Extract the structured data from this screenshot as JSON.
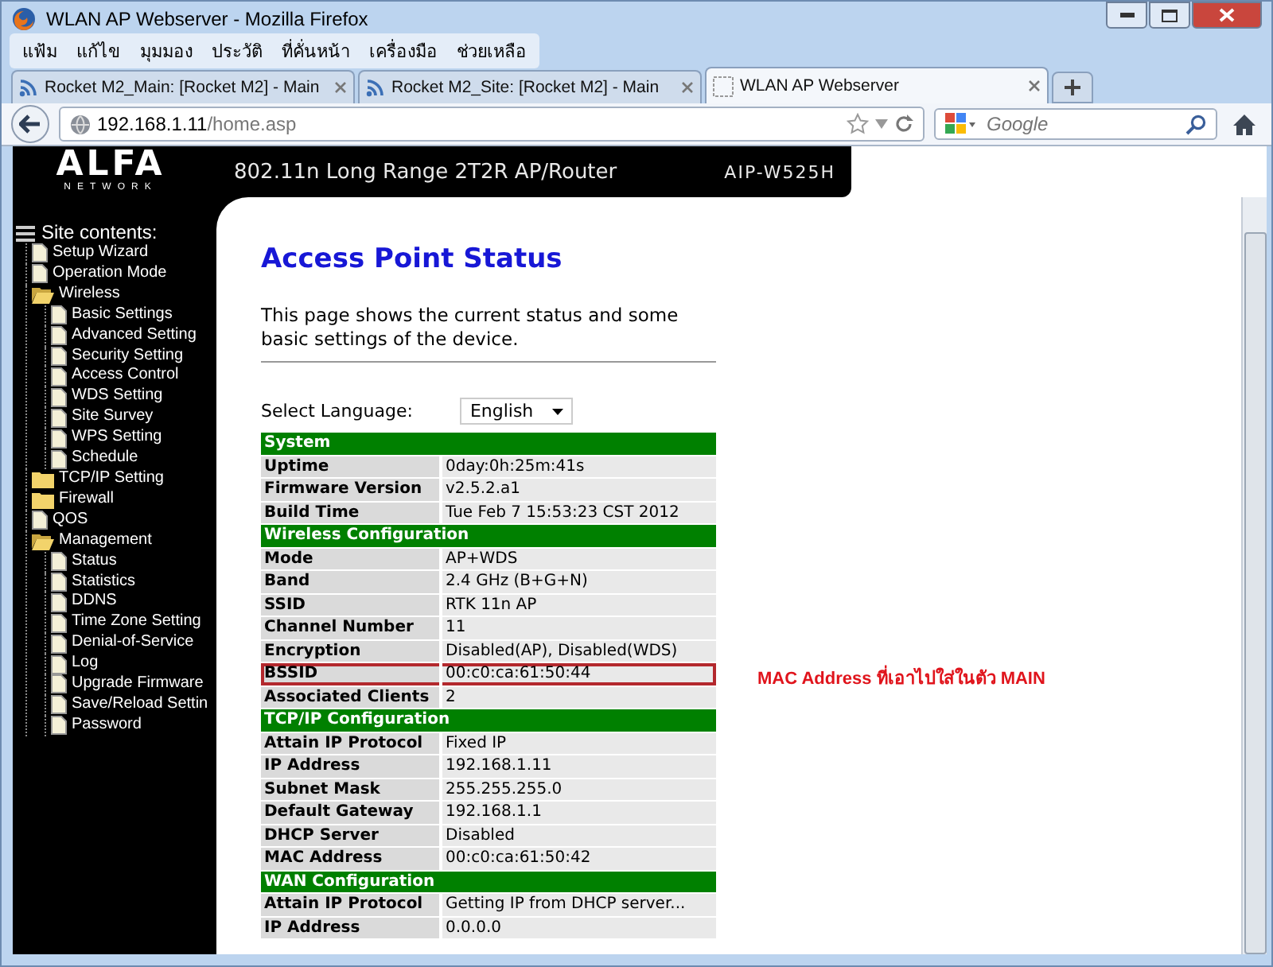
{
  "window": {
    "title": "WLAN AP Webserver - Mozilla Firefox"
  },
  "menu": [
    "แฟ้ม",
    "แก้ไข",
    "มุมมอง",
    "ประวัติ",
    "ที่คั่นหน้า",
    "เครื่องมือ",
    "ช่วยเหลือ"
  ],
  "tabs": [
    {
      "label": "Rocket M2_Main: [Rocket M2] - Main",
      "kind": "feed",
      "selected": false
    },
    {
      "label": "Rocket M2_Site: [Rocket M2] - Main",
      "kind": "feed",
      "selected": false
    },
    {
      "label": "WLAN AP Webserver",
      "kind": "blank",
      "selected": true
    }
  ],
  "address": {
    "host": "192.168.1.11",
    "path": "/home.asp"
  },
  "search": {
    "placeholder": "Google"
  },
  "banner": {
    "logo": "ALFA",
    "logo_sub": "NETWORK",
    "tagline": "802.11n Long Range 2T2R AP/Router",
    "model": "AIP-W525H"
  },
  "sidebar": {
    "title": "Site contents:",
    "items": [
      {
        "label": "Setup Wizard",
        "kind": "page"
      },
      {
        "label": "Operation Mode",
        "kind": "page"
      },
      {
        "label": "Wireless",
        "kind": "folder",
        "expanded": true,
        "children": [
          {
            "label": "Basic Settings",
            "kind": "page"
          },
          {
            "label": "Advanced Setting",
            "kind": "page"
          },
          {
            "label": "Security Setting",
            "kind": "page"
          },
          {
            "label": "Access Control",
            "kind": "page"
          },
          {
            "label": "WDS Setting",
            "kind": "page"
          },
          {
            "label": "Site Survey",
            "kind": "page"
          },
          {
            "label": "WPS Setting",
            "kind": "page"
          },
          {
            "label": "Schedule",
            "kind": "page"
          }
        ]
      },
      {
        "label": "TCP/IP Setting",
        "kind": "folder",
        "expanded": false
      },
      {
        "label": "Firewall",
        "kind": "folder",
        "expanded": false
      },
      {
        "label": "QOS",
        "kind": "page"
      },
      {
        "label": "Management",
        "kind": "folder",
        "expanded": true,
        "children": [
          {
            "label": "Status",
            "kind": "page"
          },
          {
            "label": "Statistics",
            "kind": "page"
          },
          {
            "label": "DDNS",
            "kind": "page"
          },
          {
            "label": "Time Zone Setting",
            "kind": "page"
          },
          {
            "label": "Denial-of-Service",
            "kind": "page"
          },
          {
            "label": "Log",
            "kind": "page"
          },
          {
            "label": "Upgrade Firmware",
            "kind": "page"
          },
          {
            "label": "Save/Reload Settin",
            "kind": "page"
          },
          {
            "label": "Password",
            "kind": "page"
          }
        ]
      }
    ]
  },
  "page": {
    "title": "Access Point Status",
    "description": "This page shows the current status and some basic settings of the device.",
    "language_label": "Select Language:",
    "language": "English",
    "sections": [
      {
        "title": "System",
        "rows": [
          {
            "label": "Uptime",
            "value": "0day:0h:25m:41s",
            "highlighted": false
          },
          {
            "label": "Firmware Version",
            "value": "v2.5.2.a1",
            "highlighted": false
          },
          {
            "label": "Build Time",
            "value": "Tue Feb 7 15:53:23 CST 2012",
            "highlighted": false
          }
        ]
      },
      {
        "title": "Wireless Configuration",
        "rows": [
          {
            "label": "Mode",
            "value": "AP+WDS",
            "highlighted": false
          },
          {
            "label": "Band",
            "value": "2.4 GHz (B+G+N)",
            "highlighted": false
          },
          {
            "label": "SSID",
            "value": "RTK 11n AP",
            "highlighted": false
          },
          {
            "label": "Channel Number",
            "value": "11",
            "highlighted": false
          },
          {
            "label": "Encryption",
            "value": "Disabled(AP), Disabled(WDS)",
            "highlighted": false
          },
          {
            "label": "BSSID",
            "value": "00:c0:ca:61:50:44",
            "highlighted": true
          },
          {
            "label": "Associated Clients",
            "value": "2",
            "highlighted": false
          }
        ]
      },
      {
        "title": "TCP/IP Configuration",
        "rows": [
          {
            "label": "Attain IP Protocol",
            "value": "Fixed IP",
            "highlighted": false
          },
          {
            "label": "IP Address",
            "value": "192.168.1.11",
            "highlighted": false
          },
          {
            "label": "Subnet Mask",
            "value": "255.255.255.0",
            "highlighted": false
          },
          {
            "label": "Default Gateway",
            "value": "192.168.1.1",
            "highlighted": false
          },
          {
            "label": "DHCP Server",
            "value": "Disabled",
            "highlighted": false
          },
          {
            "label": "MAC Address",
            "value": "00:c0:ca:61:50:42",
            "highlighted": false
          }
        ]
      },
      {
        "title": "WAN Configuration",
        "rows": [
          {
            "label": "Attain IP Protocol",
            "value": "Getting IP from DHCP server...",
            "highlighted": false
          },
          {
            "label": "IP Address",
            "value": "0.0.0.0",
            "highlighted": false
          }
        ]
      }
    ],
    "annotation": "MAC Address ที่เอาไปใส่ในตัว MAIN"
  }
}
